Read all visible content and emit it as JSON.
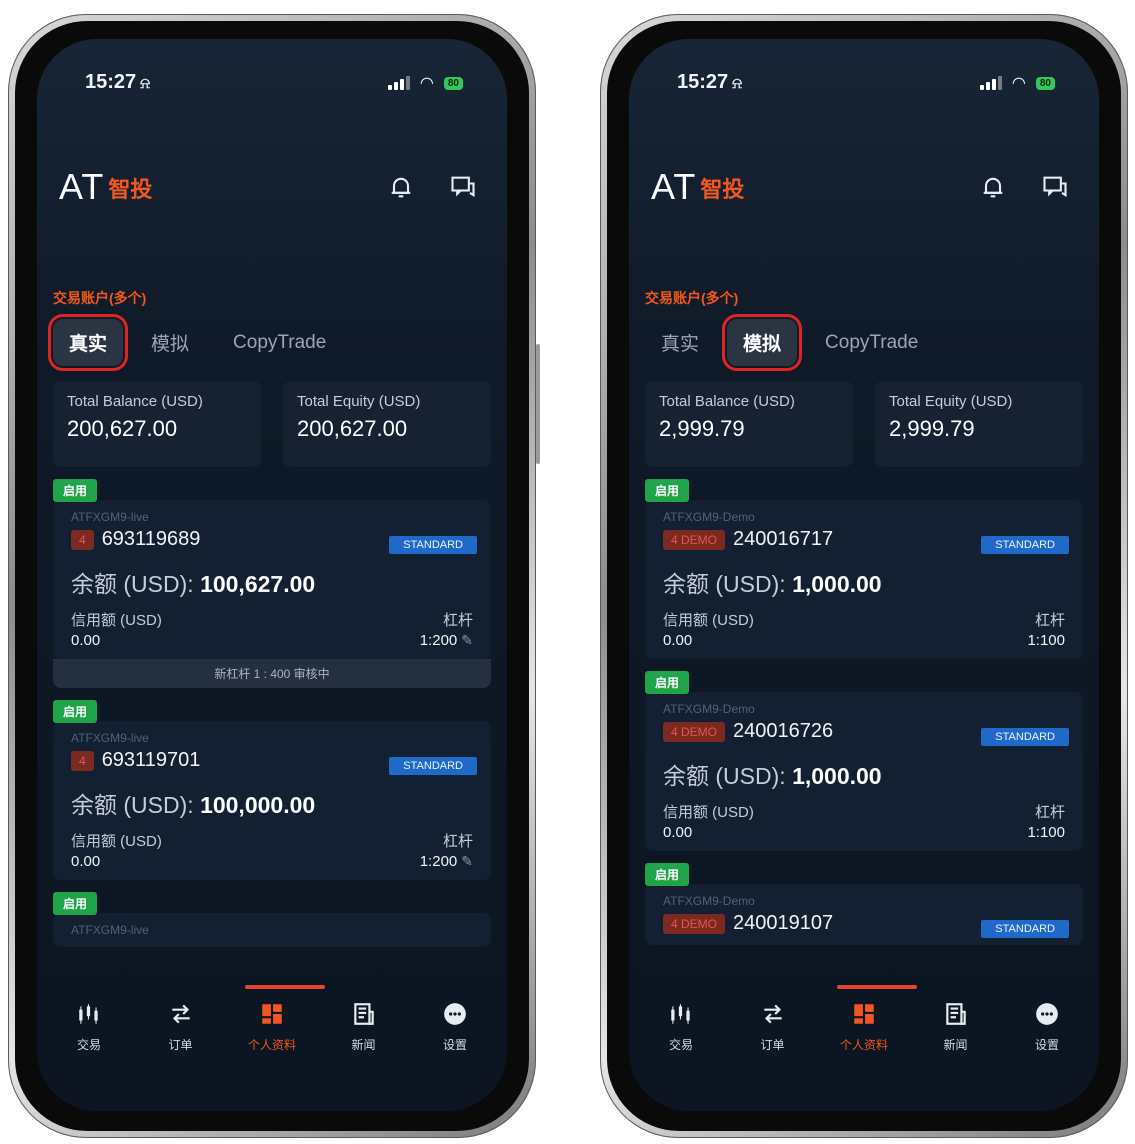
{
  "phones": [
    {
      "time": "15:27",
      "battery": "80",
      "logo": {
        "at": "AT",
        "cn": "智投"
      },
      "section_title": "交易账户(多个)",
      "tabs": [
        "真实",
        "模拟",
        "CopyTrade"
      ],
      "active_tab": 0,
      "totals": {
        "balance_label": "Total Balance (USD)",
        "balance": "200,627.00",
        "equity_label": "Total Equity (USD)",
        "equity": "200,627.00"
      },
      "accounts": [
        {
          "status": "启用",
          "server": "ATFXGM9-live",
          "tag": "4",
          "number": "693119689",
          "type": "STANDARD",
          "balance_label": "余额 (USD):",
          "balance": "100,627.00",
          "credit_label": "信用额 (USD)",
          "credit": "0.00",
          "leverage_label": "杠杆",
          "leverage": "1:200",
          "pending": "新杠杆 1 : 400 审核中"
        },
        {
          "status": "启用",
          "server": "ATFXGM9-live",
          "tag": "4",
          "number": "693119701",
          "type": "STANDARD",
          "balance_label": "余额 (USD):",
          "balance": "100,000.00",
          "credit_label": "信用额 (USD)",
          "credit": "0.00",
          "leverage_label": "杠杆",
          "leverage": "1:200"
        },
        {
          "status": "启用",
          "server": "ATFXGM9-live"
        }
      ],
      "nav": [
        "交易",
        "订单",
        "个人资料",
        "新闻",
        "设置"
      ],
      "nav_active": 2
    },
    {
      "time": "15:27",
      "battery": "80",
      "logo": {
        "at": "AT",
        "cn": "智投"
      },
      "section_title": "交易账户(多个)",
      "tabs": [
        "真实",
        "模拟",
        "CopyTrade"
      ],
      "active_tab": 1,
      "totals": {
        "balance_label": "Total Balance (USD)",
        "balance": "2,999.79",
        "equity_label": "Total Equity (USD)",
        "equity": "2,999.79"
      },
      "accounts": [
        {
          "status": "启用",
          "server": "ATFXGM9-Demo",
          "tag": "4 DEMO",
          "number": "240016717",
          "type": "STANDARD",
          "balance_label": "余额 (USD):",
          "balance": "1,000.00",
          "credit_label": "信用额 (USD)",
          "credit": "0.00",
          "leverage_label": "杠杆",
          "leverage": "1:100"
        },
        {
          "status": "启用",
          "server": "ATFXGM9-Demo",
          "tag": "4 DEMO",
          "number": "240016726",
          "type": "STANDARD",
          "balance_label": "余额 (USD):",
          "balance": "1,000.00",
          "credit_label": "信用额 (USD)",
          "credit": "0.00",
          "leverage_label": "杠杆",
          "leverage": "1:100"
        },
        {
          "status": "启用",
          "server": "ATFXGM9-Demo",
          "tag": "4 DEMO",
          "number": "240019107",
          "type": "STANDARD"
        }
      ],
      "nav": [
        "交易",
        "订单",
        "个人资料",
        "新闻",
        "设置"
      ],
      "nav_active": 2
    }
  ],
  "icons": {
    "bell": "bell-icon",
    "chat": "chat-icon",
    "trade": "candlestick-icon",
    "orders": "swap-arrows-icon",
    "profile": "grid-icon",
    "news": "news-icon",
    "settings": "more-dots-icon"
  },
  "colors": {
    "accent": "#f2581d",
    "highlight": "#e02424",
    "enabled": "#1fa44a",
    "standard": "#1f69c8",
    "bg": "#0f1a28"
  }
}
